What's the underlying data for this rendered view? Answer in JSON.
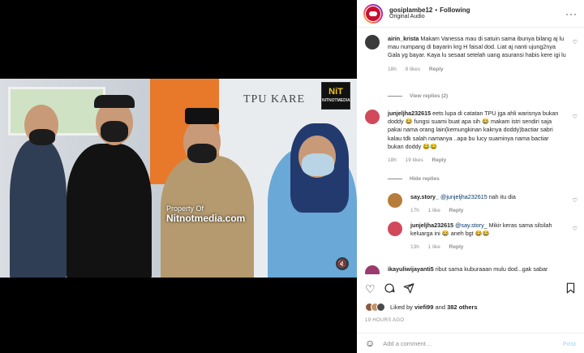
{
  "header": {
    "username": "gosiplambe12",
    "separator": "•",
    "follow_status": "Following",
    "audio": "Original Audio",
    "more_icon": "more-horizontal-icon"
  },
  "video": {
    "sign_text": "TPU KARE",
    "badge_top": "NiT",
    "badge_bottom": "NITNOTMEDIA",
    "watermark_line1": "Property Of",
    "watermark_line2": "Nitnotmedia.com",
    "sound_icon": "speaker-muted-icon"
  },
  "comments": [
    {
      "username": "airin_krista",
      "text": "Makam Vanessa mau di satuin sama ibunya bilang aj lu mau numpang di bayarin krg H faisal dod. Liat aj nanti ujung2nya Gala yg bayar. Kaya lu sesaat setelah uang asuransi habis kere igi lu",
      "time": "18h",
      "likes": "8 likes",
      "reply": "Reply",
      "view_replies": "View replies (2)",
      "avatar_color": "#3a3a3a"
    },
    {
      "username": "junjeljha232615",
      "text": "eets lupa di catatan TPU jga ahli warisnya bukan doddy 😂 fungsi suami buat apa sih 😂 makam istri sendiri saja pakai nama orang lain(kemungkinan kaknya doddy)bactiar sabri kalau tdk salah namanya ..apa bu lucy suaminya nama bactiar bukan doddy 😂😂",
      "time": "18h",
      "likes": "19 likes",
      "reply": "Reply",
      "hide_replies": "Hide replies",
      "avatar_color": "#d1495b"
    },
    {
      "username": "say.story_",
      "mention": "@junjeljha232615",
      "text": "nah itu dia",
      "time": "17h",
      "likes": "1 like",
      "reply": "Reply",
      "avatar_color": "#b77c3c"
    },
    {
      "username": "junjeljha232615",
      "mention": "@say.story_",
      "text": "Mikir keras sama silsilah keluarga ini 😂 aneh bgt 😂😂",
      "time": "13h",
      "likes": "1 like",
      "reply": "Reply",
      "avatar_color": "#d1495b"
    },
    {
      "username": "ikayuliwijayanti5",
      "text": "ribut sama kuburaaan mulu dod...gak sabar",
      "avatar_color": "#9b3a6f"
    }
  ],
  "actions": {
    "like_icon": "heart-icon",
    "comment_icon": "comment-icon",
    "share_icon": "share-icon",
    "save_icon": "bookmark-icon"
  },
  "likes": {
    "prefix": "Liked by",
    "user": "viefi99",
    "and": "and",
    "others": "382 others"
  },
  "time_ago": "19 HOURS AGO",
  "add_comment": {
    "placeholder": "Add a comment…",
    "post_label": "Post",
    "emoji_icon": "emoji-icon"
  }
}
